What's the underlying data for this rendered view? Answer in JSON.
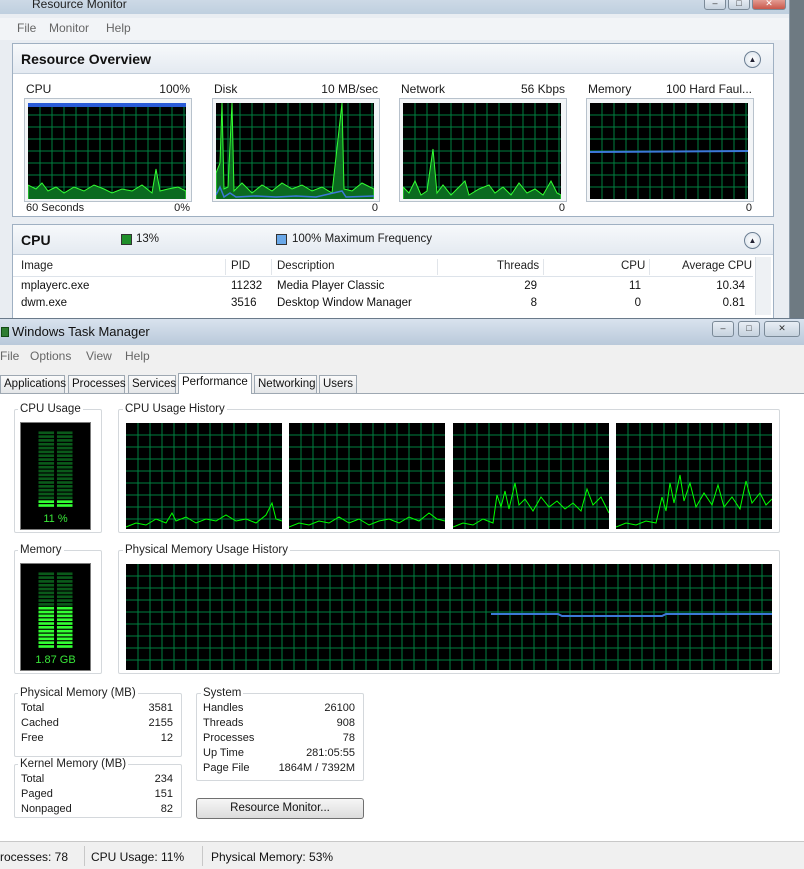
{
  "resource_monitor": {
    "title": "Resource Monitor",
    "menu": [
      "File",
      "Monitor",
      "Help"
    ],
    "overview": {
      "title": "Resource Overview",
      "graphs": [
        {
          "label": "CPU",
          "scale": "100%",
          "bottom_left": "60 Seconds",
          "bottom_right": "0%"
        },
        {
          "label": "Disk",
          "scale": "10 MB/sec",
          "bottom_left": "",
          "bottom_right": "0"
        },
        {
          "label": "Network",
          "scale": "56 Kbps",
          "bottom_left": "",
          "bottom_right": "0"
        },
        {
          "label": "Memory",
          "scale": "100 Hard Faul...",
          "bottom_left": "",
          "bottom_right": "0"
        }
      ]
    },
    "cpu_section": {
      "title": "CPU",
      "usage_legend": "13%",
      "freq_legend": "100% Maximum Frequency",
      "usage_color": "#1f8f2a",
      "freq_color": "#6aa8e8",
      "columns": [
        "Image",
        "PID",
        "Description",
        "Threads",
        "CPU",
        "Average CPU"
      ],
      "rows": [
        {
          "image": "mplayerc.exe",
          "pid": "11232",
          "description": "Media Player Classic",
          "threads": "29",
          "cpu": "11",
          "avg": "10.34"
        },
        {
          "image": "dwm.exe",
          "pid": "3516",
          "description": "Desktop Window Manager",
          "threads": "8",
          "cpu": "0",
          "avg": "0.81"
        }
      ]
    }
  },
  "task_manager": {
    "title": "Windows Task Manager",
    "menu": [
      "File",
      "Options",
      "View",
      "Help"
    ],
    "tabs": [
      "Applications",
      "Processes",
      "Services",
      "Performance",
      "Networking",
      "Users"
    ],
    "active_tab": "Performance",
    "cpu_usage": {
      "label": "CPU Usage",
      "value_text": "11 %",
      "fraction": 0.11
    },
    "cpu_history_label": "CPU Usage History",
    "memory": {
      "label": "Memory",
      "value_text": "1.87 GB",
      "fraction": 0.53
    },
    "mem_history_label": "Physical Memory Usage History",
    "physical_memory": {
      "title": "Physical Memory (MB)",
      "rows": [
        {
          "k": "Total",
          "v": "3581"
        },
        {
          "k": "Cached",
          "v": "2155"
        },
        {
          "k": "Free",
          "v": "12"
        }
      ]
    },
    "kernel_memory": {
      "title": "Kernel Memory (MB)",
      "rows": [
        {
          "k": "Total",
          "v": "234"
        },
        {
          "k": "Paged",
          "v": "151"
        },
        {
          "k": "Nonpaged",
          "v": "82"
        }
      ]
    },
    "system": {
      "title": "System",
      "rows": [
        {
          "k": "Handles",
          "v": "26100"
        },
        {
          "k": "Threads",
          "v": "908"
        },
        {
          "k": "Processes",
          "v": "78"
        },
        {
          "k": "Up Time",
          "v": "281:05:55"
        },
        {
          "k": "Page File",
          "v": "1864M / 7392M"
        }
      ]
    },
    "resource_monitor_button": "Resource Monitor...",
    "status": {
      "processes": "rocesses: 78",
      "cpu": "CPU Usage: 11%",
      "memory": "Physical Memory: 53%"
    },
    "colors": {
      "graph_grid": "#008040",
      "graph_line": "#00ff00",
      "memory_line": "#3c78d8"
    }
  }
}
